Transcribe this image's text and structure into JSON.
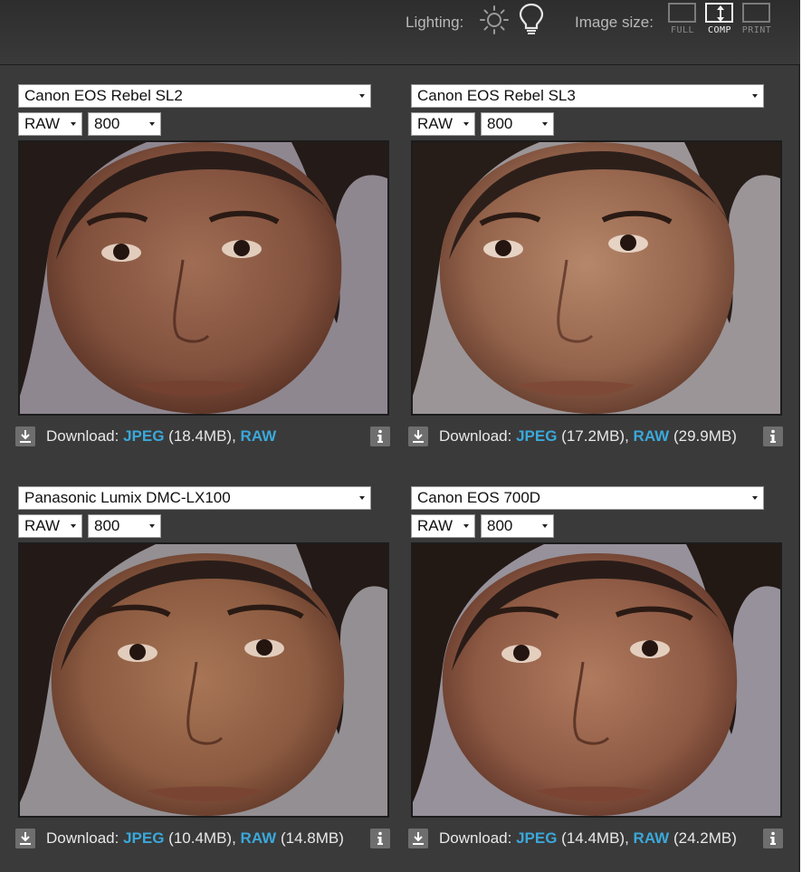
{
  "toolbar": {
    "lighting_label": "Lighting:",
    "lighting_icons": [
      "sun-icon",
      "bulb-icon"
    ],
    "image_size_label": "Image size:",
    "size_options": [
      {
        "label": "FULL",
        "active": false
      },
      {
        "label": "COMP",
        "active": true
      },
      {
        "label": "PRINT",
        "active": false
      }
    ]
  },
  "colors": {
    "link": "#3aa8db",
    "background": "#3a3a3a",
    "icon_bg": "#6e6e6e"
  },
  "panels": [
    {
      "camera": "Canon EOS Rebel SL2",
      "mode": "RAW",
      "iso": "800",
      "download_label": "Download:",
      "jpeg_label": "JPEG",
      "jpeg_size": "(18.4MB)",
      "separator": ",",
      "raw_label": "RAW",
      "raw_size": ""
    },
    {
      "camera": "Canon EOS Rebel SL3",
      "mode": "RAW",
      "iso": "800",
      "download_label": "Download:",
      "jpeg_label": "JPEG",
      "jpeg_size": "(17.2MB)",
      "separator": ",",
      "raw_label": "RAW",
      "raw_size": "(29.9MB)"
    },
    {
      "camera": "Panasonic Lumix DMC-LX100",
      "mode": "RAW",
      "iso": "800",
      "download_label": "Download:",
      "jpeg_label": "JPEG",
      "jpeg_size": "(10.4MB)",
      "separator": ",",
      "raw_label": "RAW",
      "raw_size": "(14.8MB)"
    },
    {
      "camera": "Canon EOS 700D",
      "mode": "RAW",
      "iso": "800",
      "download_label": "Download:",
      "jpeg_label": "JPEG",
      "jpeg_size": "(14.4MB)",
      "separator": ",",
      "raw_label": "RAW",
      "raw_size": "(24.2MB)"
    }
  ]
}
